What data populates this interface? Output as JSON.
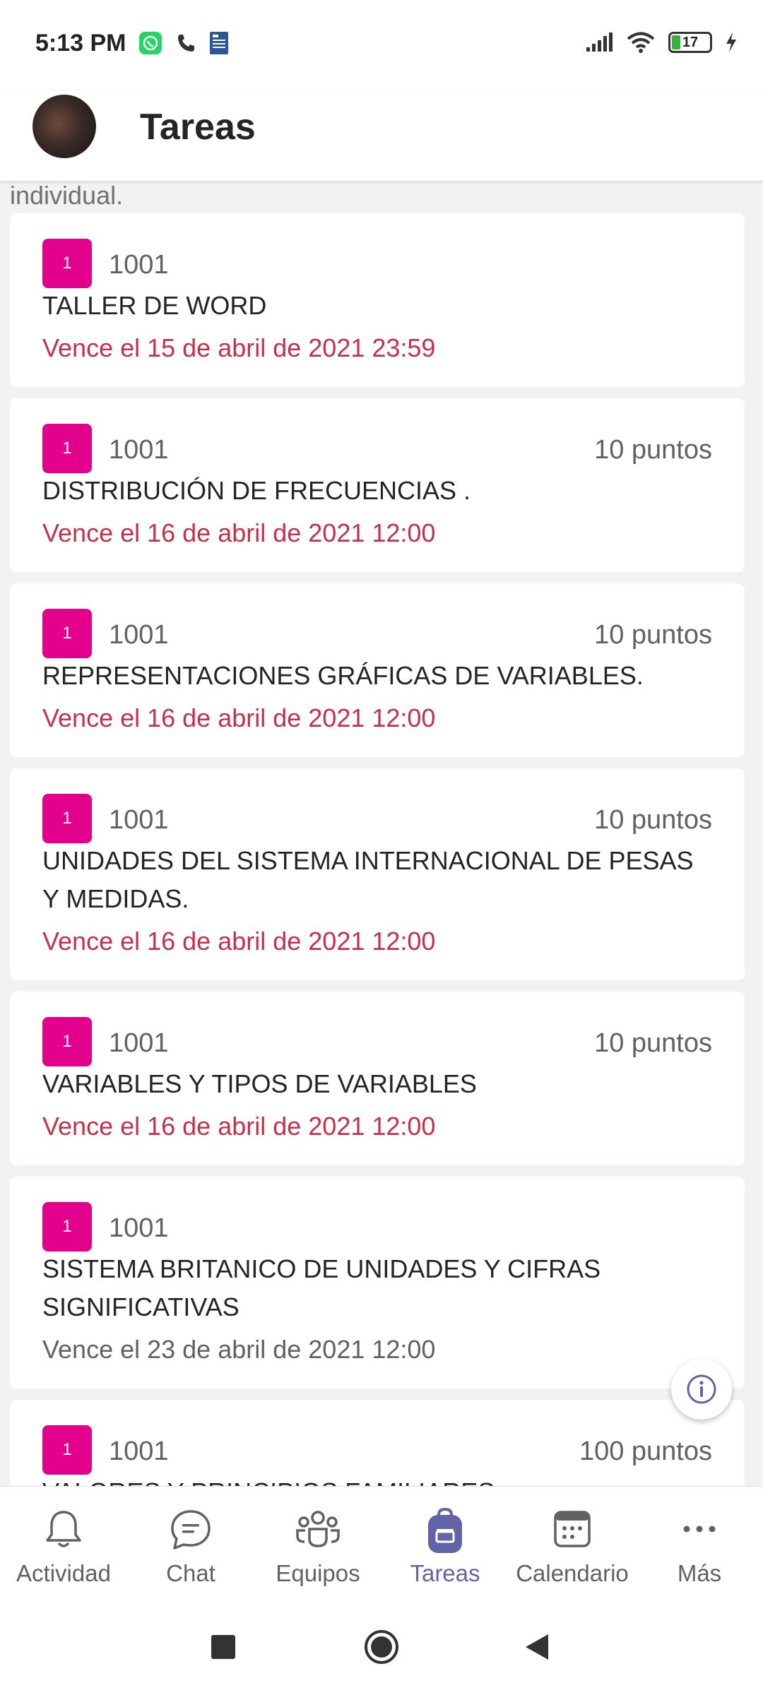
{
  "status_bar": {
    "time": "5:13 PM",
    "battery_level": "17"
  },
  "header": {
    "title": "Tareas"
  },
  "cut_off_text": "individual.",
  "assignments": [
    {
      "class_badge": "1",
      "class_name": "1001",
      "points": "",
      "title": "TALLER DE WORD",
      "due": "Vence el 15 de abril de 2021 23:59",
      "overdue": true
    },
    {
      "class_badge": "1",
      "class_name": "1001",
      "points": "10 puntos",
      "title": "DISTRIBUCIÓN DE FRECUENCIAS .",
      "due": "Vence el 16 de abril de 2021 12:00",
      "overdue": true
    },
    {
      "class_badge": "1",
      "class_name": "1001",
      "points": "10 puntos",
      "title": "REPRESENTACIONES GRÁFICAS DE VARIABLES.",
      "due": "Vence el 16 de abril de 2021 12:00",
      "overdue": true
    },
    {
      "class_badge": "1",
      "class_name": "1001",
      "points": "10 puntos",
      "title": "UNIDADES DEL SISTEMA INTERNACIONAL DE PESAS Y MEDIDAS.",
      "due": "Vence el 16 de abril de 2021 12:00",
      "overdue": true
    },
    {
      "class_badge": "1",
      "class_name": "1001",
      "points": "10 puntos",
      "title": "VARIABLES Y TIPOS DE VARIABLES",
      "due": "Vence el 16 de abril de 2021 12:00",
      "overdue": true
    },
    {
      "class_badge": "1",
      "class_name": "1001",
      "points": "",
      "title": "SISTEMA BRITANICO DE UNIDADES Y CIFRAS SIGNIFICATIVAS",
      "due": "Vence el 23 de abril de 2021 12:00",
      "overdue": false
    },
    {
      "class_badge": "1",
      "class_name": "1001",
      "points": "100 puntos",
      "title": "VALORES Y PRINCIPIOS FAMILIARES",
      "due": "",
      "overdue": false
    }
  ],
  "tabs": [
    {
      "label": "Actividad",
      "icon": "bell-icon"
    },
    {
      "label": "Chat",
      "icon": "chat-icon"
    },
    {
      "label": "Equipos",
      "icon": "teams-icon"
    },
    {
      "label": "Tareas",
      "icon": "backpack-icon",
      "active": true
    },
    {
      "label": "Calendario",
      "icon": "calendar-icon"
    },
    {
      "label": "Más",
      "icon": "more-icon"
    }
  ],
  "colors": {
    "accent": "#6264a7",
    "badge": "#e3008c",
    "overdue": "#c4314b"
  }
}
